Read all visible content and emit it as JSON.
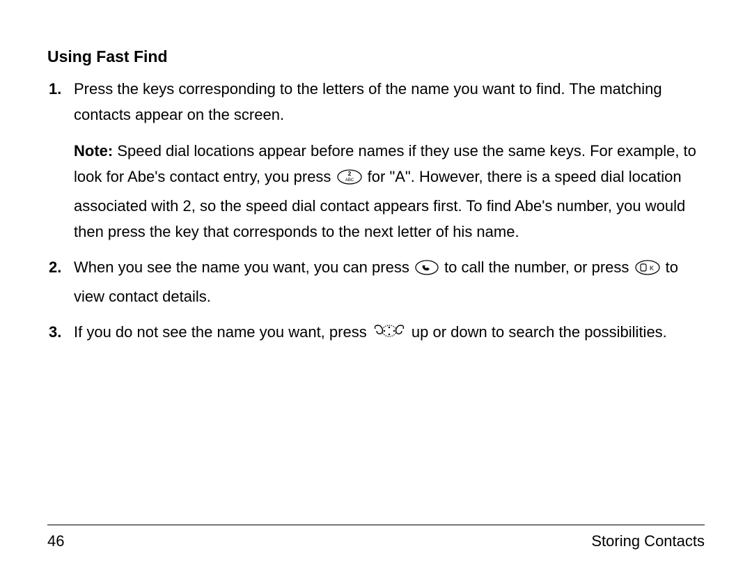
{
  "heading": "Using Fast Find",
  "items": {
    "i1": {
      "p1": "Press the keys corresponding to the letters of the name you want to find. The matching contacts appear on the screen.",
      "note_label": "Note:",
      "note_a": " Speed dial locations appear before names if they use the same keys. For example, to look for Abe's contact entry, you press ",
      "note_b": " for \"A\". However, there is a speed dial location associated with 2, so the speed dial contact appears first. To find Abe's number, you would then press the key that corresponds to the next letter of his name."
    },
    "i2": {
      "a": "When you see the name you want, you can press ",
      "b": " to call the number, or press ",
      "c": " to view contact details."
    },
    "i3": {
      "a": "If you do not see the name you want, press ",
      "b": " up or down to search the possibilities."
    }
  },
  "footer": {
    "page": "46",
    "section": "Storing Contacts"
  }
}
